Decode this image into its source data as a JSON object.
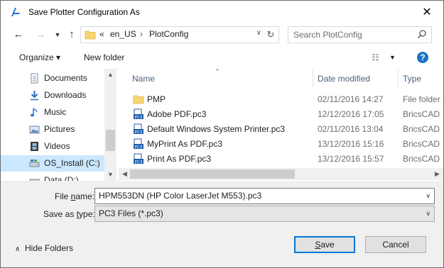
{
  "window": {
    "title": "Save Plotter Configuration As"
  },
  "navigation": {
    "back_icon": "arrow-left-icon",
    "forward_icon": "arrow-right-icon",
    "recent_icon": "chevron-down-icon",
    "up_icon": "arrow-up-icon",
    "address": {
      "overflow": "«",
      "crumbs": [
        "en_US",
        "PlotConfig"
      ]
    },
    "search_placeholder": "Search PlotConfig"
  },
  "toolbar": {
    "organize": "Organize ▾",
    "new_folder": "New folder"
  },
  "sidebar": {
    "items": [
      {
        "label": "Documents",
        "icon": "documents-icon"
      },
      {
        "label": "Downloads",
        "icon": "downloads-icon"
      },
      {
        "label": "Music",
        "icon": "music-icon"
      },
      {
        "label": "Pictures",
        "icon": "pictures-icon"
      },
      {
        "label": "Videos",
        "icon": "videos-icon"
      },
      {
        "label": "OS_Install (C:)",
        "icon": "drive-icon",
        "selected": true
      },
      {
        "label": "Data (D:)",
        "icon": "drive-icon"
      }
    ]
  },
  "file_list": {
    "columns": {
      "name": "Name",
      "date": "Date modified",
      "type": "Type"
    },
    "rows": [
      {
        "name": "PMP",
        "date": "02/11/2016 14:27",
        "type": "File folder",
        "icon": "folder-icon"
      },
      {
        "name": "Adobe PDF.pc3",
        "date": "12/12/2016 17:05",
        "type": "BricsCAD",
        "icon": "pc3-file-icon"
      },
      {
        "name": "Default Windows System Printer.pc3",
        "date": "02/11/2016 13:04",
        "type": "BricsCAD",
        "icon": "pc3-file-icon"
      },
      {
        "name": "MyPrint As PDF.pc3",
        "date": "13/12/2016 15:16",
        "type": "BricsCAD",
        "icon": "pc3-file-icon"
      },
      {
        "name": "Print As PDF.pc3",
        "date": "13/12/2016 15:57",
        "type": "BricsCAD",
        "icon": "pc3-file-icon"
      }
    ]
  },
  "form": {
    "file_name_label_pre": "File ",
    "file_name_label_ul": "n",
    "file_name_label_post": "ame:",
    "file_name_value": "HPM553DN (HP Color LaserJet M553).pc3",
    "save_type_label_pre": "Save as ",
    "save_type_label_ul": "t",
    "save_type_label_post": "ype:",
    "save_type_value": "PC3 Files (*.pc3)"
  },
  "footer": {
    "hide_folders": "Hide Folders",
    "save_ul": "S",
    "save_rest": "ave",
    "cancel": "Cancel"
  }
}
